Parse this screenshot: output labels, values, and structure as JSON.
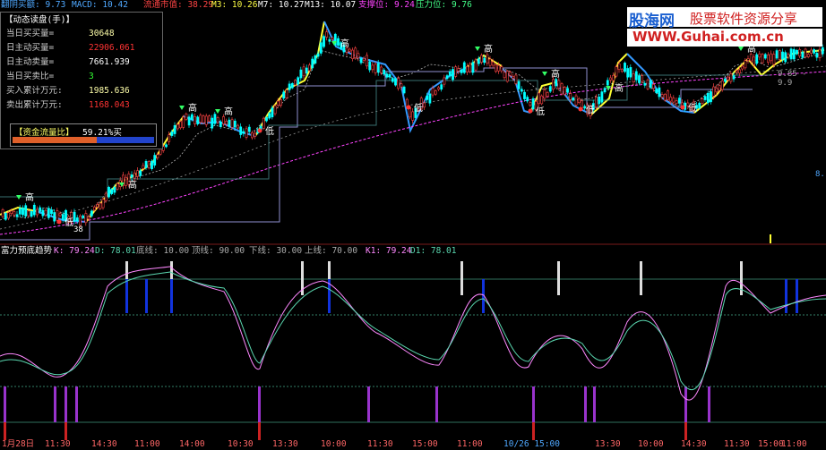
{
  "topbar": {
    "label1": "翻阴买额: 9.73",
    "label2": "MACD: 10.42",
    "label3": "流通市值: 38.29",
    "label4": "M3: 10.26",
    "label5": "M7: 10.27",
    "label6": "M13: 10.07",
    "label7": "支撑位: 9.24",
    "label8": "压力位: 9.76"
  },
  "panel": {
    "title": "【动态读盘(手)】",
    "rows": [
      {
        "label": "当日买买量=",
        "value": "30648",
        "color": "#ffffaa"
      },
      {
        "label": "日主动买量=",
        "value": "22906.061",
        "color": "#ff3333"
      },
      {
        "label": "日主动卖量=",
        "value": "7661.939",
        "color": "#ffffff"
      },
      {
        "label": "当日买卖比=",
        "value": "3",
        "color": "#33ff33"
      },
      {
        "label": "买入累计万元:",
        "value": "1985.636",
        "color": "#ffffaa"
      },
      {
        "label": "卖出累计万元:",
        "value": "1168.043",
        "color": "#ff3333"
      }
    ],
    "flow_label": "【资金流量比】",
    "flow_value": "59.21%买",
    "flow_fraction": 0.5921
  },
  "logo": {
    "brand": "股海网",
    "slogan": "股票软件资源分享",
    "url": "WWW.Guhai.com.cn"
  },
  "chart_labels": {
    "high": "高",
    "low": "低",
    "price_low": "38",
    "right_value1": "9.85 - 9.9",
    "right_value2": "8."
  },
  "midbar": {
    "name": "富力预底趋势",
    "k": "K: 79.24",
    "d": "D: 78.01",
    "floor": "底线: 10.00",
    "top": "顶线: 90.00",
    "lower": "下线: 30.00",
    "upper": "上线: 70.00",
    "k1": "K1: 79.24",
    "d1": "D1: 78.01"
  },
  "xaxis": [
    "1月28日",
    "11:30",
    "14:30",
    "11:00",
    "14:00",
    "10:30",
    "13:30",
    "10:00",
    "11:30",
    "15:00",
    "11:00",
    "10/26 15:00",
    "13:30",
    "10:00",
    "14:30",
    "11:30",
    "15:00",
    "11:00"
  ],
  "colors": {
    "up": "#ff4444",
    "down": "#00ffff",
    "yellow": "#ffff33",
    "blue": "#3399ff",
    "magenta": "#ff44ff",
    "teal": "#5ad8b0",
    "purple": "#9933cc"
  }
}
